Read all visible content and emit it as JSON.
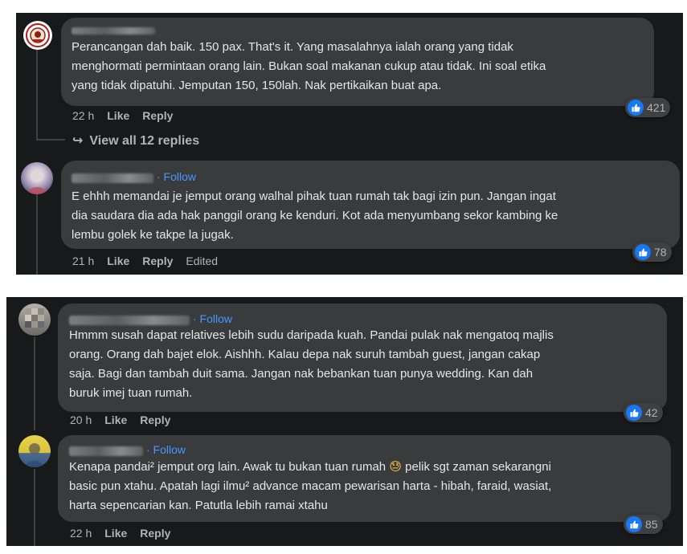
{
  "panel1": {
    "comment1": {
      "text": "Perancangan dah baik. 150 pax. That's it. Yang masalahnya ialah orang yang tidak\nmenghormati permintaan orang lain. Bukan soal makanan cukup atau tidak. Ini soal etika\nyang tidak dipatuhi. Jemputan 150, 150lah. Nak pertikaikan buat apa.",
      "time": "22 h",
      "like": "Like",
      "reply": "Reply",
      "reactions": "421"
    },
    "view_replies": {
      "arrow": "↪",
      "label": "View all 12 replies"
    },
    "comment2": {
      "follow": "· Follow",
      "text": "E ehhh memandai je jemput orang walhal pihak tuan rumah tak bagi izin pun. Jangan ingat\ndia saudara dia ada hak panggil orang ke kenduri. Kot ada menyumbang sekor kambing ke\nlembu golek ke takpe la jugak.",
      "time": "21 h",
      "like": "Like",
      "reply": "Reply",
      "edited": "Edited",
      "reactions": "78"
    }
  },
  "panel2": {
    "comment3": {
      "follow": "· Follow",
      "text": "Hmmm susah dapat relatives lebih sudu daripada kuah. Pandai pulak nak mengatoq majlis\norang. Orang dah bajet elok. Aishhh. Kalau depa nak suruh tambah guest, jangan cakap\nsaja. Bagi dan tambah duit sama. Jangan nak bebankan tuan punya wedding. Kan dah\nburuk imej tuan rumah.",
      "time": "20 h",
      "like": "Like",
      "reply": "Reply",
      "reactions": "42"
    },
    "comment4": {
      "follow": "· Follow",
      "text_before_emoji": "Kenapa pandai² jemput org lain. Awak tu bukan tuan rumah ",
      "emoji": "😓",
      "text_after_emoji": " pelik sgt zaman sekarangni\nbasic pun xtahu. Apatah lagi ilmu² advance macam pewarisan harta - hibah, faraid, wasiat,\nharta sepencarian kan. Patutla lebih ramai xtahu",
      "time": "22 h",
      "like": "Like",
      "reply": "Reply",
      "reactions": "85"
    }
  },
  "colors": {
    "panel_bg": "#18191a",
    "bubble_bg": "#3a3b3c",
    "text": "#e4e6eb",
    "meta_text": "#b0b3b8",
    "follow_blue": "#4599ff",
    "like_blue": "#1877f2"
  },
  "icons": {
    "reaction": "thumbs-up-icon",
    "view_replies": "reply-arrow-icon"
  }
}
